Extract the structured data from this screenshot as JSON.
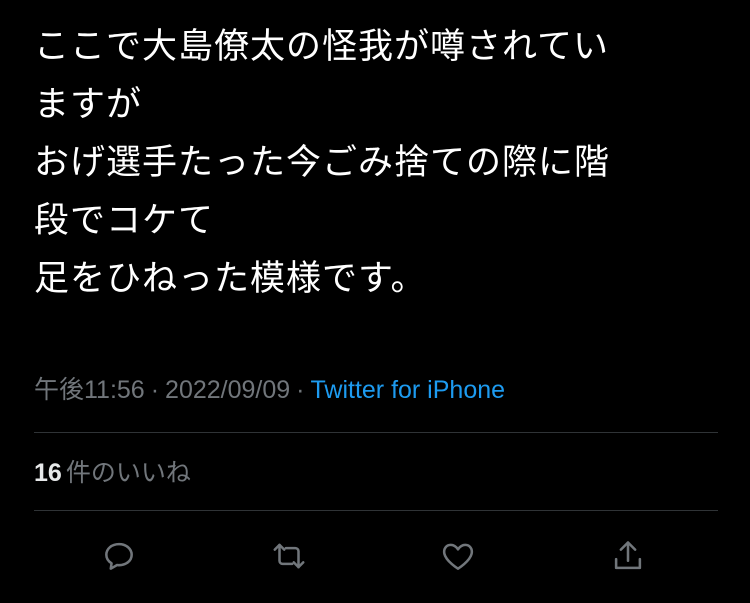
{
  "tweet": {
    "text_lines": [
      "ここで大島僚太の怪我が噂されてい",
      "ますが",
      "おげ選手たった今ごみ捨ての際に階",
      "段でコケて",
      "足をひねった模様です。"
    ],
    "time": "午後11:56",
    "date": "2022/09/09",
    "separator": "·",
    "source": "Twitter for iPhone"
  },
  "likes": {
    "count": "16",
    "label": "件のいいね"
  },
  "actions": {
    "reply_icon": "reply-icon",
    "retweet_icon": "retweet-icon",
    "like_icon": "heart-icon",
    "share_icon": "share-icon"
  },
  "colors": {
    "background": "#000000",
    "text": "#ffffff",
    "muted": "#71767b",
    "link": "#1d9bf0",
    "divider": "#2f3336"
  }
}
